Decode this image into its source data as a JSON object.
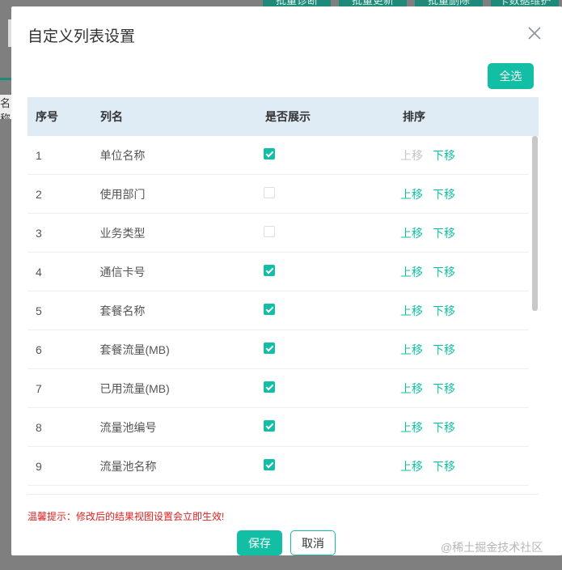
{
  "background": {
    "toolbar_buttons": [
      "批量诊断",
      "批量更新",
      "批量删除",
      "卡数据维护"
    ],
    "left_label": "名称"
  },
  "dialog": {
    "title": "自定义列表设置",
    "select_all_label": "全选",
    "columns": [
      "序号",
      "列名",
      "是否展示",
      "排序"
    ],
    "move_up_label": "上移",
    "move_down_label": "下移",
    "rows": [
      {
        "index": "1",
        "name": "单位名称",
        "shown": true,
        "up_disabled": true
      },
      {
        "index": "2",
        "name": "使用部门",
        "shown": false,
        "up_disabled": false
      },
      {
        "index": "3",
        "name": "业务类型",
        "shown": false,
        "up_disabled": false
      },
      {
        "index": "4",
        "name": "通信卡号",
        "shown": true,
        "up_disabled": false
      },
      {
        "index": "5",
        "name": "套餐名称",
        "shown": true,
        "up_disabled": false
      },
      {
        "index": "6",
        "name": "套餐流量(MB)",
        "shown": true,
        "up_disabled": false
      },
      {
        "index": "7",
        "name": "已用流量(MB)",
        "shown": true,
        "up_disabled": false
      },
      {
        "index": "8",
        "name": "流量池编号",
        "shown": true,
        "up_disabled": false
      },
      {
        "index": "9",
        "name": "流量池名称",
        "shown": true,
        "up_disabled": false
      }
    ],
    "tip": "温馨提示：修改后的结果视图设置会立即生效!",
    "save_label": "保存",
    "cancel_label": "取消"
  },
  "watermark": "@稀土掘金技术社区",
  "colors": {
    "accent": "#13bfa4",
    "header_bg": "#dfebf5",
    "tip": "#e02020"
  }
}
